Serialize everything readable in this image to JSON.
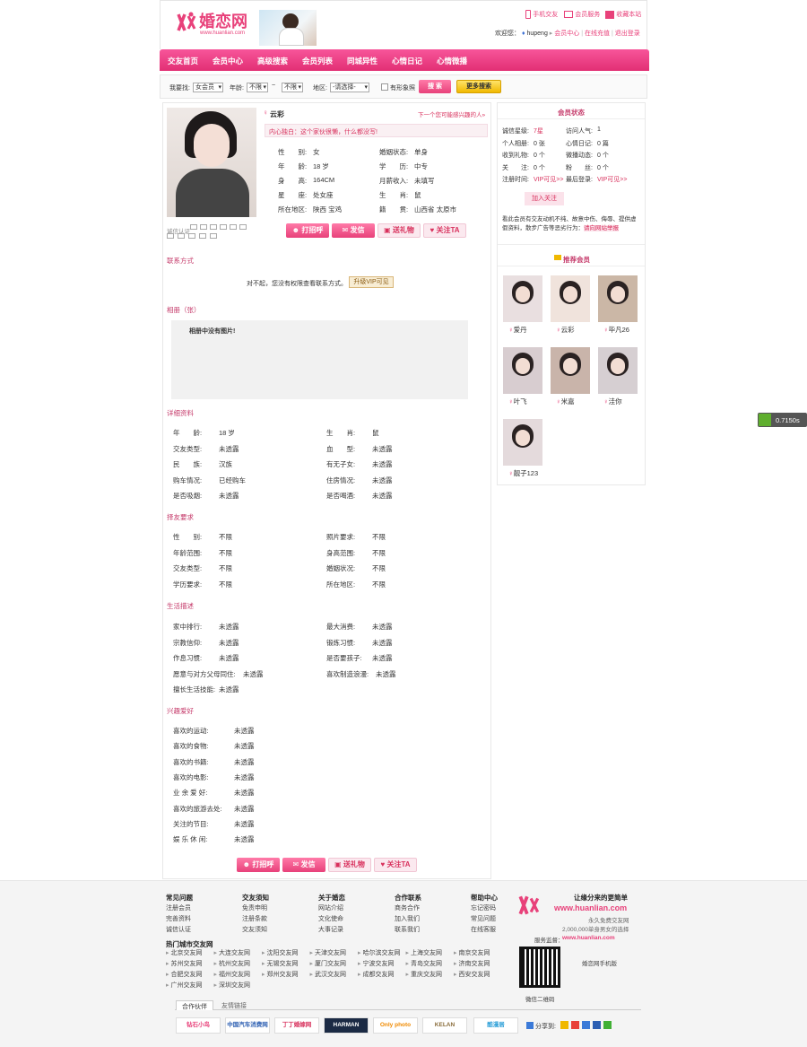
{
  "header": {
    "logo_text": "婚恋网",
    "logo_url": "www.huanlian.com",
    "links": [
      "手机交友",
      "会员服务",
      "收藏本站"
    ],
    "welcome": "欢迎您：",
    "username": "hupeng",
    "user_links": [
      "会员中心",
      "在线充值",
      "退出登录"
    ]
  },
  "nav": [
    "交友首页",
    "会员中心",
    "高级搜索",
    "会员列表",
    "同城异性",
    "心情日记",
    "心情微播"
  ],
  "search": {
    "label": "我要找:",
    "gender": "女会员",
    "age_label": "年龄:",
    "age_from": "不限",
    "age_sep": "~",
    "age_to": "不限",
    "region_label": "地区:",
    "region": "-请选择-",
    "photo_label": "有形象照",
    "search_btn": "搜 索",
    "more_btn": "更多搜索"
  },
  "profile": {
    "name": "云彩",
    "next_link": "下一个您可能感兴趣的人»",
    "monologue": "内心独白：这个家伙很懒，什么都没写!",
    "verify_label": "诚信认证",
    "fields": [
      [
        "性　　别:",
        "女",
        "婚姻状态:",
        "单身"
      ],
      [
        "年　　龄:",
        "18 岁",
        "学　　历:",
        "中专"
      ],
      [
        "身　　高:",
        "164CM",
        "月薪收入:",
        "未填写"
      ],
      [
        "星　　座:",
        "处女座",
        "生　　肖:",
        "鼠"
      ],
      [
        "所在地区:",
        "陕西 宝鸡",
        "籍　　贯:",
        "山西省 太原市"
      ]
    ],
    "actions": [
      "打招呼",
      "发信",
      "送礼物",
      "关注TA"
    ]
  },
  "contact": {
    "title": "联系方式",
    "text": "对不起，您没有权限查看联系方式。",
    "btn": "升级VIP可见"
  },
  "album": {
    "title": "相册（张）",
    "empty": "相册中没有图片!"
  },
  "details": {
    "title": "详细资料",
    "rows": [
      [
        "年　　龄:",
        "18 岁",
        "生　　肖:",
        "鼠"
      ],
      [
        "交友类型:",
        "未透露",
        "血　　型:",
        "未透露"
      ],
      [
        "民　　族:",
        "汉族",
        "有无子女:",
        "未透露"
      ],
      [
        "购车情况:",
        "已经购车",
        "住房情况:",
        "未透露"
      ],
      [
        "是否吸烟:",
        "未透露",
        "是否喝酒:",
        "未透露"
      ]
    ]
  },
  "partner": {
    "title": "择友要求",
    "rows": [
      [
        "性　　别:",
        "不限",
        "照片要求:",
        "不限"
      ],
      [
        "年龄范围:",
        "不限",
        "身高范围:",
        "不限"
      ],
      [
        "交友类型:",
        "不限",
        "婚姻状况:",
        "不限"
      ],
      [
        "学历要求:",
        "不限",
        "所在地区:",
        "不限"
      ]
    ]
  },
  "life": {
    "title": "生活描述",
    "rows": [
      [
        "家中排行:",
        "未透露",
        "最大消费:",
        "未透露"
      ],
      [
        "宗教信仰:",
        "未透露",
        "锻炼习惯:",
        "未透露"
      ],
      [
        "作息习惯:",
        "未透露",
        "是否要孩子:",
        "未透露"
      ],
      [
        "愿意与对方父母同住:",
        "未透露",
        "喜欢制造浪漫:",
        "未透露"
      ],
      [
        "擅长生活技能:",
        "未透露",
        "",
        ""
      ]
    ]
  },
  "hobby": {
    "title": "兴趣爱好",
    "rows": [
      [
        "喜欢的运动:",
        "未透露"
      ],
      [
        "喜欢的食物:",
        "未透露"
      ],
      [
        "喜欢的书籍:",
        "未透露"
      ],
      [
        "喜欢的电影:",
        "未透露"
      ],
      [
        "业 余 爱 好:",
        "未透露"
      ],
      [
        "喜欢的旅游去处:",
        "未透露"
      ],
      [
        "关注的节目:",
        "未透露"
      ],
      [
        "娱 乐 休 闲:",
        "未透露"
      ]
    ]
  },
  "status": {
    "title": "会员状态",
    "rows": [
      [
        "诚信星级:",
        "7星",
        "访问人气:",
        "1"
      ],
      [
        "个人相册:",
        "0 张",
        "心情日记:",
        "0 篇"
      ],
      [
        "收到礼物:",
        "0 个",
        "微播动态:",
        "0 个"
      ],
      [
        "关　　注:",
        "0 个",
        "粉　　丝:",
        "0 个"
      ]
    ],
    "reg_label": "注册时间:",
    "reg_val": "VIP可见>>",
    "last_label": "最后登录:",
    "last_val": "VIP可见>>",
    "follow_btn": "加入关注",
    "notice": "看此会员有交友动机不纯、故意中伤、侮辱、提供虚假资料，散步广告等恶劣行为：",
    "report": "请向网站举报"
  },
  "recommend": {
    "title": "推荐会员",
    "members": [
      "爱丹",
      "云彩",
      "毕凡26",
      "叶飞",
      "米嘉",
      "洼你",
      "靓子123"
    ]
  },
  "timer": "0.7150s",
  "footer": {
    "cols": [
      {
        "h": "常见问题",
        "items": [
          "注册会员",
          "完善资料",
          "诚信认证"
        ]
      },
      {
        "h": "交友须知",
        "items": [
          "免责申明",
          "注册条款",
          "交友须知"
        ]
      },
      {
        "h": "关于婚恋",
        "items": [
          "网站介绍",
          "文化使命",
          "大事记录"
        ]
      },
      {
        "h": "合作联系",
        "items": [
          "商务合作",
          "加入我们",
          "联系我们"
        ]
      },
      {
        "h": "帮助中心",
        "items": [
          "忘记密码",
          "常见问题",
          "在线客服"
        ]
      }
    ],
    "city_title": "热门城市交友网",
    "cities": [
      "北京交友网",
      "大连交友网",
      "沈阳交友网",
      "天津交友网",
      "哈尔滨交友网",
      "上海交友网",
      "南京交友网",
      "苏州交友网",
      "杭州交友网",
      "无锡交友网",
      "厦门交友网",
      "宁波交友网",
      "青岛交友网",
      "济南交友网",
      "合肥交友网",
      "福州交友网",
      "郑州交友网",
      "武汉交友网",
      "成都交友网",
      "重庆交友网",
      "西安交友网",
      "广州交友网",
      "深圳交友网"
    ],
    "slogan": "让缘分来的更简单",
    "site": "www.huanlian.com",
    "free": "永久免费交友网",
    "members": "2,000,000单身男女的选择",
    "service_label": "服务监督：",
    "service_url": "www.huanlian.com",
    "qr_label": "微信二维码",
    "mobile": "婚恋网手机版",
    "tabs": [
      "合作伙伴",
      "友情链接"
    ],
    "partners": [
      "钻石小鸟",
      "中国汽车消费网",
      "丁丁婚嫁网",
      "HARMAN",
      "Only photo",
      "KELAN",
      "酷漫居"
    ],
    "share": "分享到:"
  }
}
